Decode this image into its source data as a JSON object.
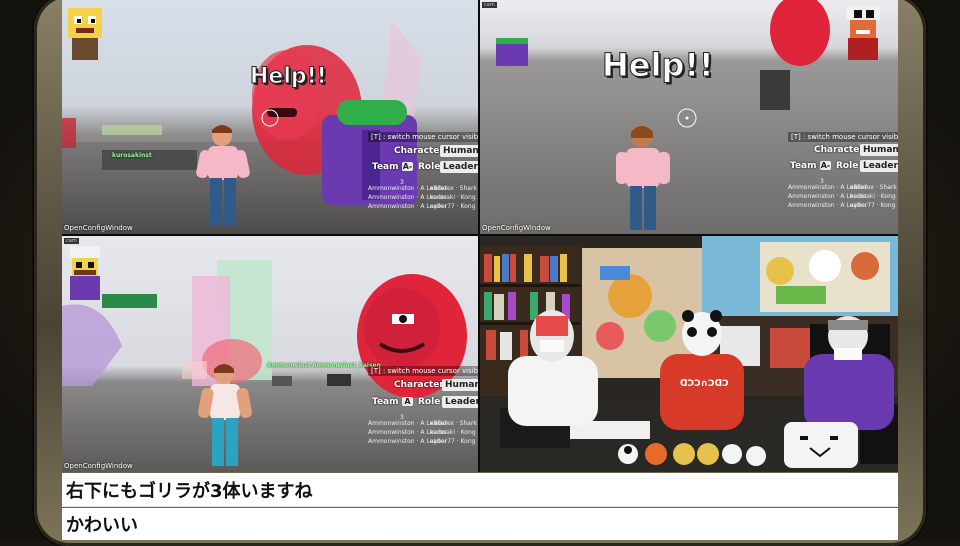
{
  "panels": {
    "top_left": {
      "help_text": "Help!!",
      "hint": "[T] : switch mouse cursor visibility",
      "character_label": "Character :",
      "character_value": "Human-",
      "team_label": "Team :",
      "team_value": "A-",
      "role_label": "Role :",
      "role_value": "Leader-",
      "score_count": "3",
      "left_scores": [
        "Ammonwinston · A Leader",
        "Ammonwinston · A Leader",
        "Ammonwinston · A Leader"
      ],
      "right_scores": [
        "xBladex · Shark",
        "kurosaki · Kong",
        "ayber77 · Kong"
      ],
      "footer": "OpenConfigWindow",
      "nametag": "kurosakinst"
    },
    "top_right": {
      "help_text": "Help!!",
      "hint": "[T] : switch mouse cursor visibility",
      "character_label": "Character :",
      "character_value": "Human-",
      "team_label": "Team :",
      "team_value": "A-",
      "role_label": "Role :",
      "role_value": "Leader-",
      "score_count": "3",
      "left_scores": [
        "Ammonwinston · A Leader",
        "Ammonwinston · A Leader",
        "Ammonwinston · A Leader"
      ],
      "right_scores": [
        "xBladex · Shark",
        "kurosaki · Kong",
        "ayber77 · Kong"
      ],
      "footer": "OpenConfigWindow"
    },
    "bottom_left": {
      "hint": "[T] : switch mouse cursor visibility",
      "character_label": "Character :",
      "character_value": "Human",
      "team_label": "Team :",
      "team_value": "A",
      "role_label": "Role :",
      "role_value": "Leader",
      "score_count": "3",
      "left_scores": [
        "Ammonwinston · A Leader",
        "Ammonwinston · A Leader",
        "Ammonwinston · A Leader"
      ],
      "right_scores": [
        "xBladex · Shark",
        "kurosaki · Kong",
        "ayber77 · Kong"
      ],
      "footer": "OpenConfigWindow",
      "nametags": [
        "Ammonwinst",
        "Ammonwinst_kaisen"
      ]
    }
  },
  "chat": [
    "右下にもゴリラが3体いますね",
    "かわいい"
  ],
  "colors": {
    "help_fill": "#ffffff",
    "gorilla_red": "#e0243a",
    "chat_bg": "#ffffff",
    "bezel": "#6a624c"
  }
}
